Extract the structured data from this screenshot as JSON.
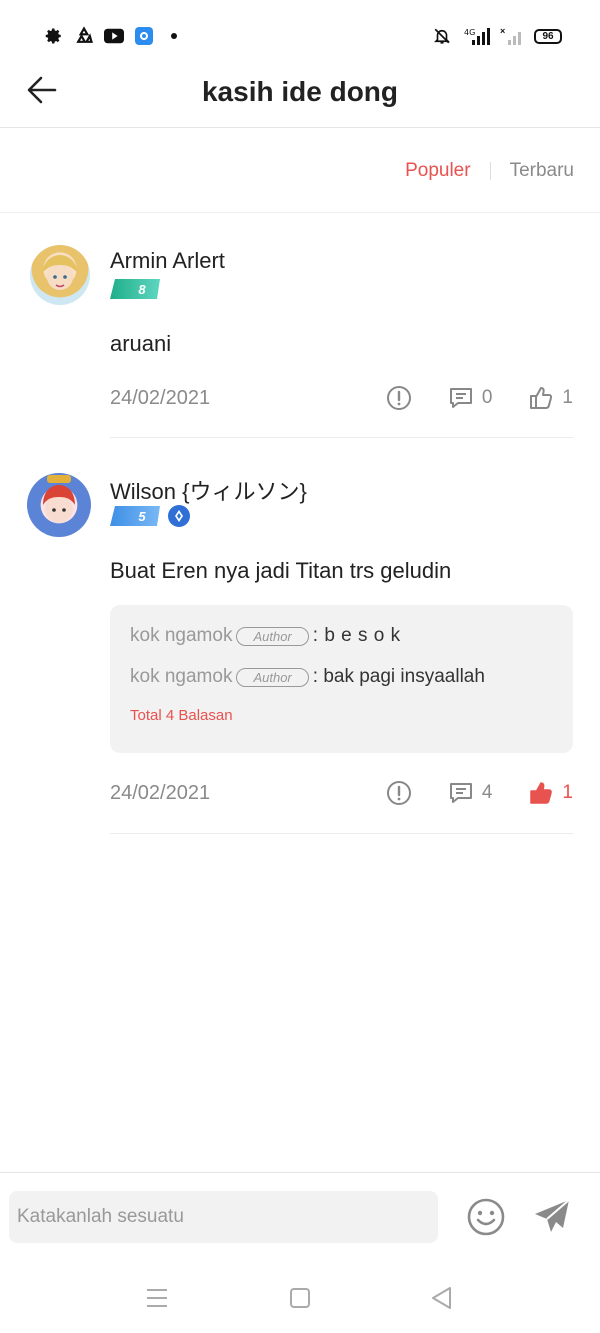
{
  "status_bar": {
    "left_icons": [
      "gear-icon",
      "recycle-icon",
      "youtube-icon",
      "app-icon",
      "dot-icon"
    ],
    "right_icons": [
      "bell-off-icon",
      "signal-4g-icon",
      "signal-icon"
    ],
    "network": "4G",
    "battery": "96"
  },
  "header": {
    "title": "kasih ide dong",
    "back_icon": "arrow-left-icon"
  },
  "sort_tabs": {
    "popular": "Populer",
    "latest": "Terbaru",
    "active": "popular",
    "active_color": "#e8524f"
  },
  "comments": [
    {
      "username": "Armin Arlert",
      "level": "8",
      "text": "aruani",
      "date": "24/02/2021",
      "reply_count": "0",
      "like_count": "1",
      "liked": false
    },
    {
      "username": "Wilson {ウィルソン}",
      "level": "5",
      "text": "Buat Eren nya jadi Titan trs geludin",
      "date": "24/02/2021",
      "reply_count": "4",
      "like_count": "1",
      "liked": true,
      "replies": [
        {
          "user": "kok ngamok",
          "badge": "Author",
          "text": ": b e s o k"
        },
        {
          "user": "kok ngamok",
          "badge": "Author",
          "text": ": bak pagi insyaallah"
        }
      ],
      "more_replies": "Total 4 Balasan"
    }
  ],
  "input_bar": {
    "placeholder": "Katakanlah sesuatu"
  }
}
